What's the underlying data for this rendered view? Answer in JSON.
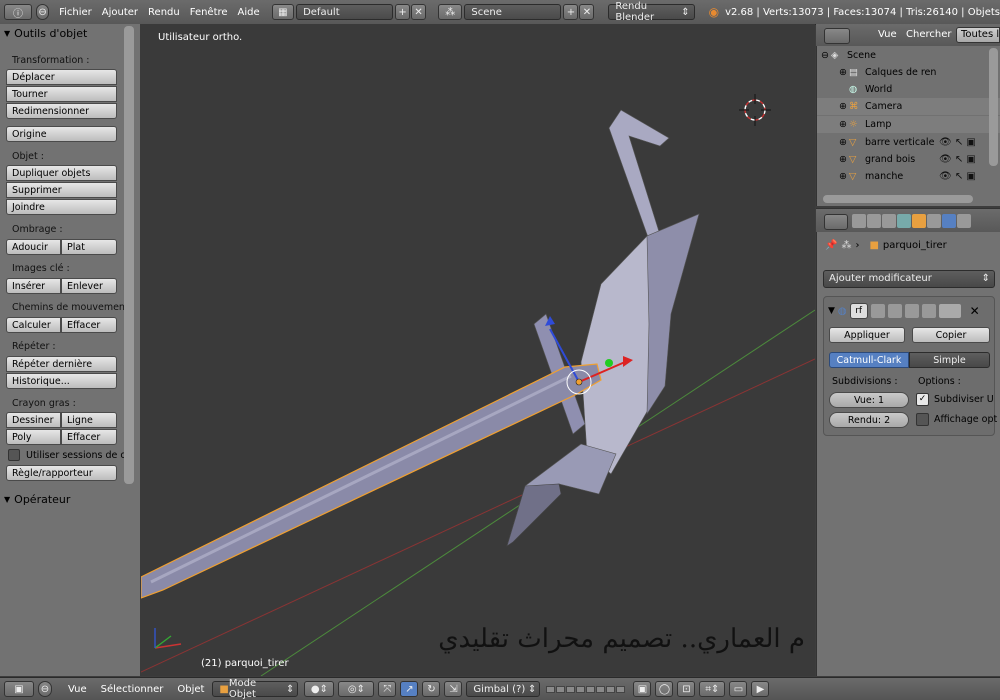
{
  "topbar": {
    "menus": [
      "Fichier",
      "Ajouter",
      "Rendu",
      "Fenêtre",
      "Aide"
    ],
    "screen_layout": "Default",
    "scene": "Scene",
    "render_engine": "Rendu Blender",
    "stats": "v2.68 | Verts:13073 | Faces:13074 | Tris:26140 | Objets"
  },
  "toolshelf": {
    "title": "Outils d'objet",
    "transformation_label": "Transformation :",
    "btn_move": "Déplacer",
    "btn_rotate": "Tourner",
    "btn_scale": "Redimensionner",
    "btn_origin": "Origine",
    "objet_label": "Objet :",
    "btn_duplicate": "Dupliquer objets",
    "btn_delete": "Supprimer",
    "btn_join": "Joindre",
    "shading_label": "Ombrage :",
    "btn_smooth": "Adoucir",
    "btn_flat": "Plat",
    "keyframes_label": "Images clé :",
    "btn_insert": "Insérer",
    "btn_remove": "Enlever",
    "motion_paths_label": "Chemins de mouvemen",
    "btn_calculate": "Calculer",
    "btn_clear": "Effacer",
    "repeat_label": "Répéter :",
    "btn_repeat_last": "Répéter dernière",
    "btn_history": "Historique...",
    "grease_label": "Crayon gras :",
    "btn_draw": "Dessiner",
    "btn_line": "Ligne",
    "btn_poly": "Poly",
    "btn_erase": "Effacer",
    "use_sessions": "Utiliser sessions de c",
    "btn_ruler": "Règle/rapporteur",
    "operator_title": "Opérateur"
  },
  "viewport": {
    "view_label": "Utilisateur ortho.",
    "object_label": "(21) parquoi_tirer",
    "watermark": "م العماري.. تصميم محراث تقليدي"
  },
  "outliner": {
    "tab_view": "Vue",
    "tab_search": "Chercher",
    "tab_all": "Toutes le",
    "rows": [
      {
        "label": "Scene"
      },
      {
        "label": "Calques de ren"
      },
      {
        "label": "World"
      },
      {
        "label": "Camera"
      },
      {
        "label": "Lamp"
      },
      {
        "label": "barre verticale"
      },
      {
        "label": "grand bois"
      },
      {
        "label": "manche"
      }
    ]
  },
  "properties": {
    "object_name": "parquoi_tirer",
    "add_modifier": "Ajouter modificateur",
    "modifier_name": "rf",
    "btn_apply": "Appliquer",
    "btn_copy": "Copier",
    "tab_catmull": "Catmull-Clark",
    "tab_simple": "Simple",
    "subdivisions_label": "Subdivisions :",
    "options_label": "Options :",
    "view_field": "Vue: 1",
    "render_field": "Rendu: 2",
    "subdivide_uv": "Subdiviser U",
    "optimal_display": "Affichage opt"
  },
  "bottombar": {
    "menu_view": "Vue",
    "menu_select": "Sélectionner",
    "menu_object": "Objet",
    "mode": "Mode Objet",
    "orientation": "Gimbal (?)"
  },
  "colors": {
    "accent_blue": "#5680c2",
    "selection_orange": "#f0a030",
    "axis_red": "#a33",
    "axis_green": "#5a5"
  }
}
